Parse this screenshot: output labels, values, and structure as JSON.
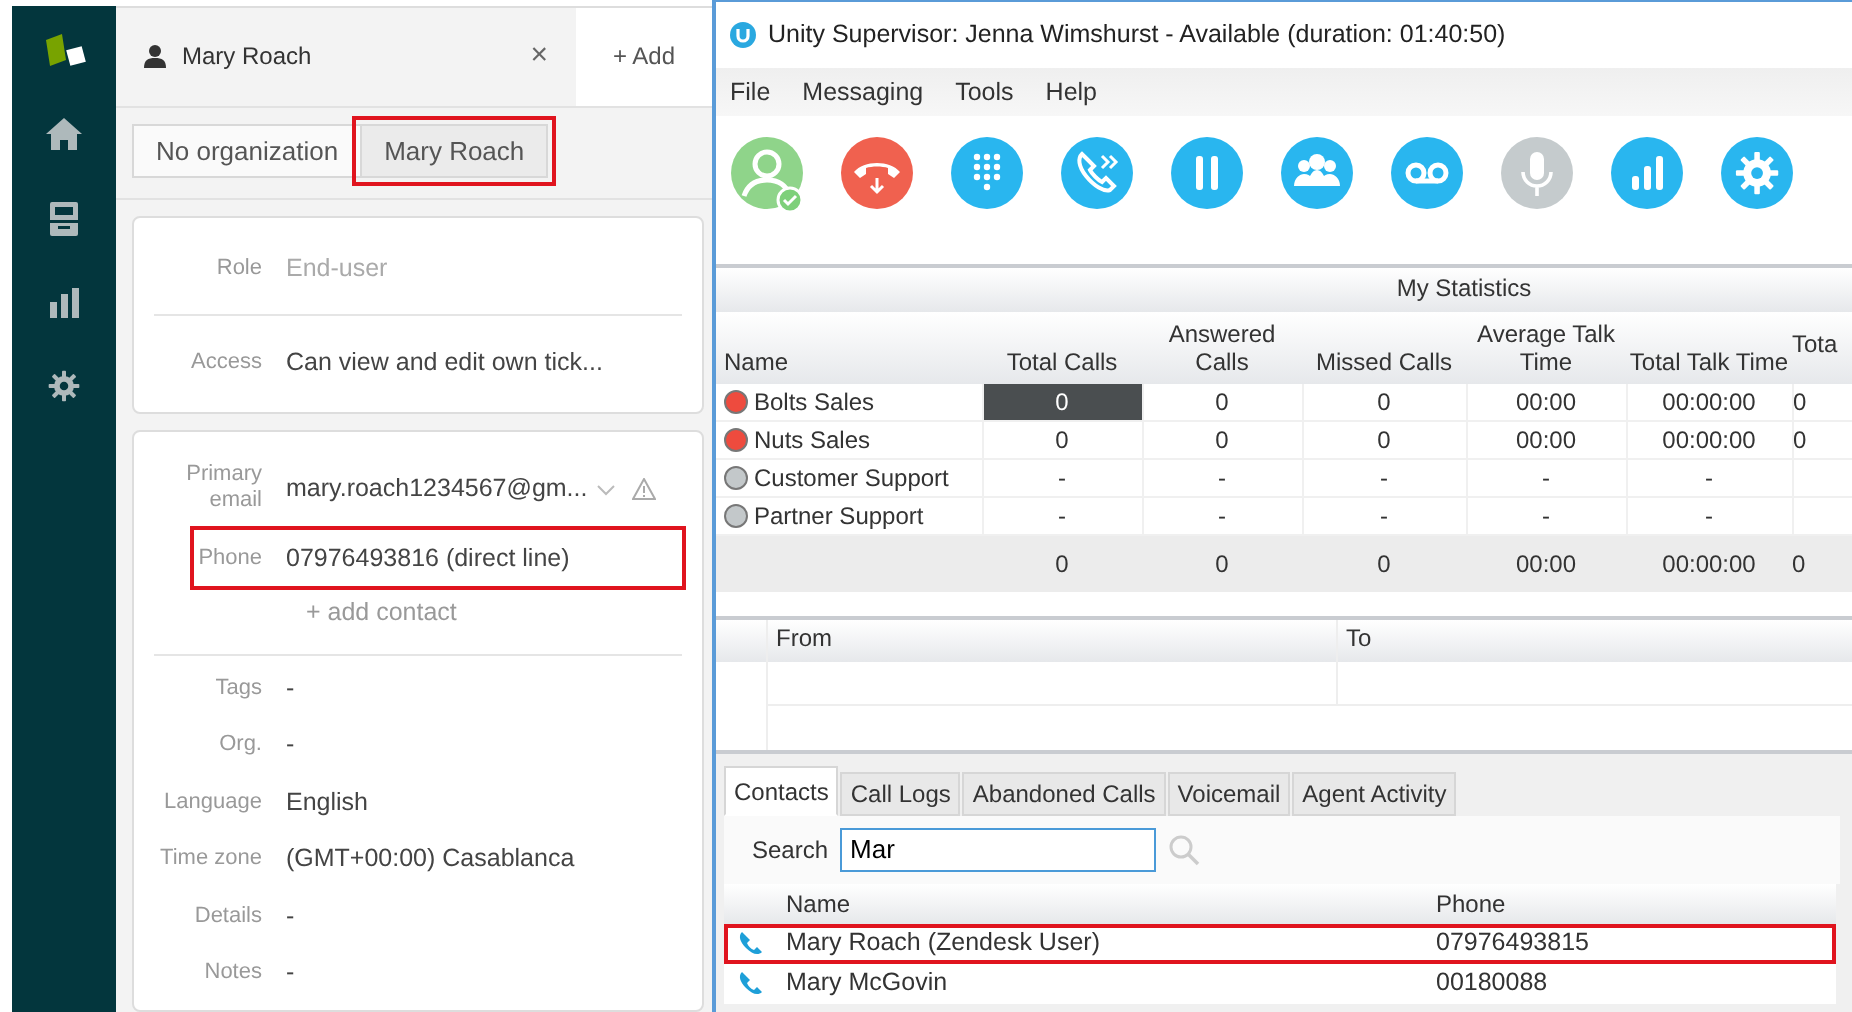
{
  "left_panel": {
    "tab": {
      "title": "Mary Roach",
      "close": "×"
    },
    "add_tab": "+ Add",
    "org_buttons": [
      {
        "label": "No organization",
        "selected": false,
        "highlighted": false
      },
      {
        "label": "Mary Roach",
        "selected": true,
        "highlighted": true
      }
    ],
    "summary_fields": [
      {
        "label": "Role",
        "value": "End-user",
        "muted": true
      },
      {
        "label": "Access",
        "value": "Can view and edit own tick...",
        "muted": false
      }
    ],
    "contact_fields": [
      {
        "label": "Primary email",
        "value": "mary.roach1234567@gm...",
        "kind": "email",
        "highlighted": false
      },
      {
        "label": "Phone",
        "value": "07976493816 (direct line)",
        "kind": "phone",
        "highlighted": true
      }
    ],
    "add_contact": "+ add contact",
    "detail_fields": [
      {
        "label": "Tags",
        "value": "-"
      },
      {
        "label": "Org.",
        "value": "-"
      },
      {
        "label": "Language",
        "value": "English"
      },
      {
        "label": "Time zone",
        "value": "(GMT+00:00) Casablanca"
      },
      {
        "label": "Details",
        "value": "-"
      },
      {
        "label": "Notes",
        "value": "-"
      }
    ]
  },
  "window": {
    "title": "Unity Supervisor: Jenna Wimshurst - Available (duration: 01:40:50)"
  },
  "menu": [
    "File",
    "Messaging",
    "Tools",
    "Help"
  ],
  "toolbar": [
    {
      "kind": "status",
      "disabled": false
    },
    {
      "kind": "hangup",
      "disabled": false
    },
    {
      "kind": "dialpad",
      "disabled": false
    },
    {
      "kind": "transfer",
      "disabled": false
    },
    {
      "kind": "hold",
      "disabled": false
    },
    {
      "kind": "conference",
      "disabled": false
    },
    {
      "kind": "voicemail",
      "disabled": false
    },
    {
      "kind": "microphone",
      "disabled": true
    },
    {
      "kind": "statistics",
      "disabled": false
    },
    {
      "kind": "settings",
      "disabled": false
    }
  ],
  "statistics": {
    "group_heading": "My Statistics",
    "columns": [
      "Name",
      "Total Calls",
      "Answered Calls",
      "Missed Calls",
      "Average Talk Time",
      "Total Talk Time",
      "Tota"
    ],
    "rows": [
      {
        "name": "Bolts Sales",
        "color": "#ee4b3e",
        "selected": true,
        "values": [
          "0",
          "0",
          "0",
          "00:00",
          "00:00:00",
          "0"
        ]
      },
      {
        "name": "Nuts Sales",
        "color": "#ee4b3e",
        "selected": false,
        "values": [
          "0",
          "0",
          "0",
          "00:00",
          "00:00:00",
          "0"
        ]
      },
      {
        "name": "Customer Support",
        "color": "#c3c8ca",
        "selected": false,
        "values": [
          "-",
          "-",
          "-",
          "-",
          "-"
        ]
      },
      {
        "name": "Partner Support",
        "color": "#c3c8ca",
        "selected": false,
        "values": [
          "-",
          "-",
          "-",
          "-",
          "-"
        ]
      }
    ],
    "totals": [
      "0",
      "0",
      "0",
      "00:00",
      "00:00:00",
      "0"
    ]
  },
  "calls_grid": {
    "columns": [
      "From",
      "To"
    ]
  },
  "tabs": [
    {
      "label": "Contacts",
      "selected": true
    },
    {
      "label": "Call Logs",
      "selected": false
    },
    {
      "label": "Abandoned Calls",
      "selected": false
    },
    {
      "label": "Voicemail",
      "selected": false
    },
    {
      "label": "Agent Activity",
      "selected": false
    }
  ],
  "search": {
    "label": "Search",
    "value": "Mar"
  },
  "contacts": {
    "columns": [
      "Name",
      "Phone"
    ],
    "rows": [
      {
        "name": "Mary Roach (Zendesk User)",
        "phone": "07976493815",
        "highlighted": true
      },
      {
        "name": "Mary McGovin",
        "phone": "00180088",
        "highlighted": false
      }
    ]
  }
}
